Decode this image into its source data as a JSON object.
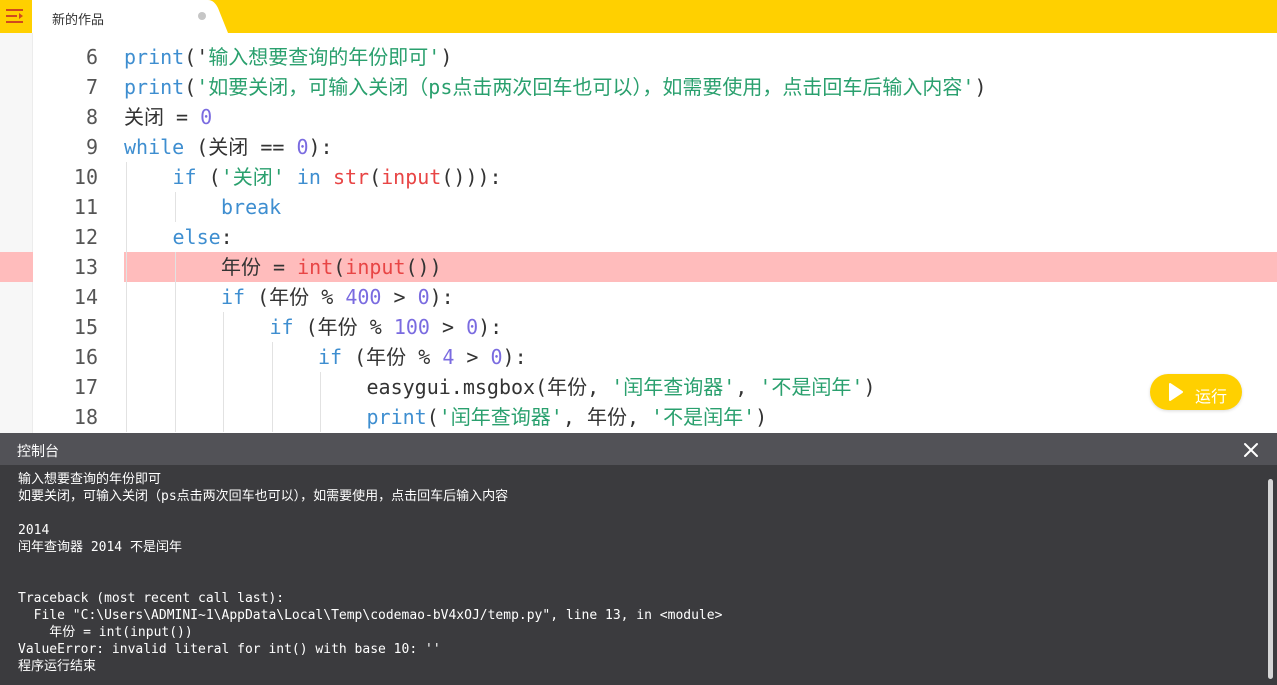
{
  "tab": {
    "title": "新的作品"
  },
  "editor": {
    "lines": [
      {
        "num": "6",
        "indent": 0,
        "tokens": [
          {
            "t": "print",
            "c": "fn"
          },
          {
            "t": "('",
            "c": "plain"
          },
          {
            "t": "输入想要查询的年份即可'",
            "c": "str"
          },
          {
            "t": ")",
            "c": "plain"
          }
        ]
      },
      {
        "num": "7",
        "indent": 0,
        "tokens": [
          {
            "t": "print",
            "c": "fn"
          },
          {
            "t": "(",
            "c": "plain"
          },
          {
            "t": "'如要关闭，可输入关闭（ps点击两次回车也可以），如需要使用，点击回车后输入内容'",
            "c": "str"
          },
          {
            "t": ")",
            "c": "plain"
          }
        ]
      },
      {
        "num": "8",
        "indent": 0,
        "tokens": [
          {
            "t": "关闭 = ",
            "c": "plain"
          },
          {
            "t": "0",
            "c": "num"
          }
        ]
      },
      {
        "num": "9",
        "indent": 0,
        "tokens": [
          {
            "t": "while",
            "c": "kw"
          },
          {
            "t": " (关闭 == ",
            "c": "plain"
          },
          {
            "t": "0",
            "c": "num"
          },
          {
            "t": "):",
            "c": "plain"
          }
        ]
      },
      {
        "num": "10",
        "indent": 1,
        "tokens": [
          {
            "t": "if",
            "c": "kw"
          },
          {
            "t": " (",
            "c": "plain"
          },
          {
            "t": "'关闭'",
            "c": "str"
          },
          {
            "t": " ",
            "c": "plain"
          },
          {
            "t": "in",
            "c": "kw"
          },
          {
            "t": " ",
            "c": "plain"
          },
          {
            "t": "str",
            "c": "builtin"
          },
          {
            "t": "(",
            "c": "plain"
          },
          {
            "t": "input",
            "c": "builtin"
          },
          {
            "t": "())):",
            "c": "plain"
          }
        ]
      },
      {
        "num": "11",
        "indent": 2,
        "tokens": [
          {
            "t": "break",
            "c": "kw"
          }
        ]
      },
      {
        "num": "12",
        "indent": 1,
        "tokens": [
          {
            "t": "else",
            "c": "kw"
          },
          {
            "t": ":",
            "c": "plain"
          }
        ]
      },
      {
        "num": "13",
        "indent": 2,
        "error": true,
        "tokens": [
          {
            "t": "年份 = ",
            "c": "plain"
          },
          {
            "t": "int",
            "c": "builtin"
          },
          {
            "t": "(",
            "c": "plain"
          },
          {
            "t": "input",
            "c": "builtin"
          },
          {
            "t": "())",
            "c": "plain"
          }
        ]
      },
      {
        "num": "14",
        "indent": 2,
        "tokens": [
          {
            "t": "if",
            "c": "kw"
          },
          {
            "t": " (年份 % ",
            "c": "plain"
          },
          {
            "t": "400",
            "c": "num"
          },
          {
            "t": " > ",
            "c": "plain"
          },
          {
            "t": "0",
            "c": "num"
          },
          {
            "t": "):",
            "c": "plain"
          }
        ]
      },
      {
        "num": "15",
        "indent": 3,
        "tokens": [
          {
            "t": "if",
            "c": "kw"
          },
          {
            "t": " (年份 % ",
            "c": "plain"
          },
          {
            "t": "100",
            "c": "num"
          },
          {
            "t": " > ",
            "c": "plain"
          },
          {
            "t": "0",
            "c": "num"
          },
          {
            "t": "):",
            "c": "plain"
          }
        ]
      },
      {
        "num": "16",
        "indent": 4,
        "tokens": [
          {
            "t": "if",
            "c": "kw"
          },
          {
            "t": " (年份 % ",
            "c": "plain"
          },
          {
            "t": "4",
            "c": "num"
          },
          {
            "t": " > ",
            "c": "plain"
          },
          {
            "t": "0",
            "c": "num"
          },
          {
            "t": "):",
            "c": "plain"
          }
        ]
      },
      {
        "num": "17",
        "indent": 5,
        "tokens": [
          {
            "t": "easygui.msgbox(年份, ",
            "c": "plain"
          },
          {
            "t": "'闰年查询器'",
            "c": "str"
          },
          {
            "t": ", ",
            "c": "plain"
          },
          {
            "t": "'不是闰年'",
            "c": "str"
          },
          {
            "t": ")",
            "c": "plain"
          }
        ]
      },
      {
        "num": "18",
        "indent": 5,
        "tokens": [
          {
            "t": "print",
            "c": "fn"
          },
          {
            "t": "(",
            "c": "plain"
          },
          {
            "t": "'闰年查询器'",
            "c": "str"
          },
          {
            "t": ", 年份, ",
            "c": "plain"
          },
          {
            "t": "'不是闰年'",
            "c": "str"
          },
          {
            "t": ")",
            "c": "plain"
          }
        ]
      }
    ]
  },
  "run_button": {
    "label": "运行"
  },
  "console": {
    "title": "控制台",
    "lines": [
      "输入想要查询的年份即可",
      "如要关闭，可输入关闭（ps点击两次回车也可以），如需要使用，点击回车后输入内容",
      "",
      "2014",
      "闰年查询器 2014 不是闰年",
      "",
      "",
      "Traceback (most recent call last):",
      "  File \"C:\\Users\\ADMINI~1\\AppData\\Local\\Temp\\codemao-bV4xOJ/temp.py\", line 13, in <module>",
      "    年份 = int(input())",
      "ValueError: invalid literal for int() with base 10: ''",
      "程序运行结束"
    ]
  },
  "colors": {
    "accent": "#ffd000",
    "error_line": "#ffbcbc",
    "console_bg": "#3b3b3e",
    "console_header": "#525257"
  },
  "icons": {
    "menu": "menu-indent-icon",
    "close": "close-icon",
    "run": "play-icon"
  }
}
